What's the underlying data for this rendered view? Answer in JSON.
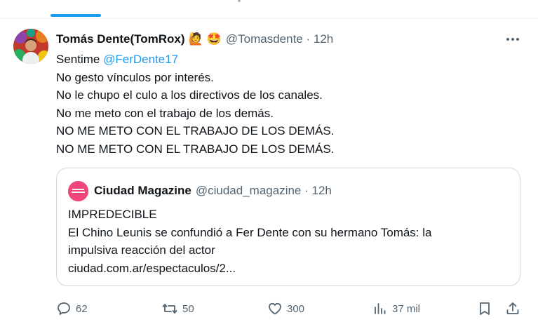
{
  "colors": {
    "accent": "#1d9bf0",
    "secondary_text": "#536471",
    "border": "#cfd9de",
    "quote_avatar": "#f0467a"
  },
  "tweet": {
    "author_name": "Tomás Dente(TomRox)",
    "emojis": [
      "🙋",
      "🤩"
    ],
    "handle_time": "@Tomasdente · 12h",
    "lines": [
      {
        "prefix": "Sentime ",
        "mention": "@FerDente17"
      },
      {
        "text": "No gesto vínculos por interés."
      },
      {
        "text": "No le chupo el culo a los directivos de los canales."
      },
      {
        "text": "No me meto con el trabajo de los demás."
      },
      {
        "text": "NO ME METO CON EL TRABAJO DE LOS DEMÁS."
      },
      {
        "text": "NO ME METO CON EL TRABAJO DE LOS DEMÁS."
      }
    ]
  },
  "quote": {
    "author_name": "Ciudad Magazine",
    "handle_time": "@ciudad_magazine · 12h",
    "lines": [
      "IMPREDECIBLE",
      "El Chino Leunis se confundió a Fer Dente con su hermano Tomás: la",
      "impulsiva reacción del actor",
      "ciudad.com.ar/espectaculos/2..."
    ]
  },
  "actions": {
    "replies": "62",
    "retweets": "50",
    "likes": "300",
    "views": "37 mil"
  },
  "icons": [
    "more-icon",
    "reply-icon",
    "retweet-icon",
    "like-icon",
    "views-icon",
    "bookmark-icon",
    "share-icon"
  ]
}
